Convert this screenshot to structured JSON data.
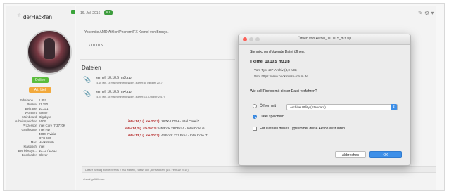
{
  "sidebar": {
    "username": "derHackfan",
    "badge_online": "Online",
    "badge_rank": "Alt. Lief",
    "stats": [
      {
        "k": "Erhaltene ...",
        "v": "1.857"
      },
      {
        "k": "Punkte",
        "v": "11.150"
      },
      {
        "k": "Beiträge",
        "v": "10.331"
      },
      {
        "k": "Wohnort",
        "v": "Scene"
      },
      {
        "k": "Mainboard",
        "v": "Gigabyte"
      },
      {
        "k": "Arbeitsspeicher",
        "v": "16GB"
      },
      {
        "k": "Prozessor",
        "v": "Intel Core i7-3770K"
      },
      {
        "k": "Grafikkarte",
        "v": "Intel HD"
      },
      {
        "k": "",
        "v": "4000, Nvidia"
      },
      {
        "k": "",
        "v": "GTX 670"
      },
      {
        "k": "Mac",
        "v": "Hackintosh"
      },
      {
        "k": "Klassisch",
        "v": "Intel"
      },
      {
        "k": "Betriebssys...",
        "v": "10.13 / 10.12"
      },
      {
        "k": "Bootloader",
        "v": "Clover"
      }
    ]
  },
  "post": {
    "date": "16. Juli 2016",
    "number": "#1",
    "intro": "Yosemite AMD Athlon/Phenom/FX Kernel von Bronya.",
    "bullet": "• 10.10.5",
    "files_title": "Dateien",
    "files": [
      {
        "name": "kernel_10.10.5_m3.zip",
        "meta": "(4,16 MB, 18 mal heruntergeladen, zuletzt: 8. Oktober 2017)"
      },
      {
        "name": "kernel_10.10.5_m4.zip",
        "meta": "(4,25 MB, 48 mal heruntergeladen, zuletzt: 14. Oktober 2017)"
      }
    ],
    "config_lines": [
      {
        "key": "iMac14,2 (Late 2013):",
        "rest": " Z87X-UD3H - Intel Core i7"
      },
      {
        "key": "iMac14,2 (Late 2013):",
        "rest": " H5Rock Z87 Pro4 - Intel Core i5"
      },
      {
        "key": "iMac13,2 (Late 2012):",
        "rest": " ASRock Z77 Pro4 - Intel Core i7"
      }
    ],
    "footer_note": "Dieser Beitrag wurde bereits 2 mal editiert, zuletzt von „derHackfan“ (15. Februar 2017)",
    "footer_note2": "ritscal gefällt das."
  },
  "dialog": {
    "title": "Öffnen von kernel_10.10.5_m3.zip",
    "question": "Sie möchten folgende Datei öffnen:",
    "filename": "kernel_10.10.5_m3.zip",
    "type_line": "Vom Typ:  ZIP-Archiv (4,0 MB)",
    "from_line": "Von:  https://www.hackintosh-forum.de",
    "question2": "Wie soll Firefox mit dieser Datei verfahren?",
    "open_with_label": "Öffnen mit",
    "open_with_value": "Archive Utility (Standard)",
    "save_label": "Datei speichern",
    "always_label": "Für Dateien dieses Typs immer diese Aktion ausführen",
    "cancel_label": "Abbrechen",
    "ok_label": "OK"
  },
  "colors": {
    "accent": "#3d8fe8",
    "online": "#5bbd3c",
    "rank": "#f2a93c",
    "post_number": "#3d9c3d"
  }
}
